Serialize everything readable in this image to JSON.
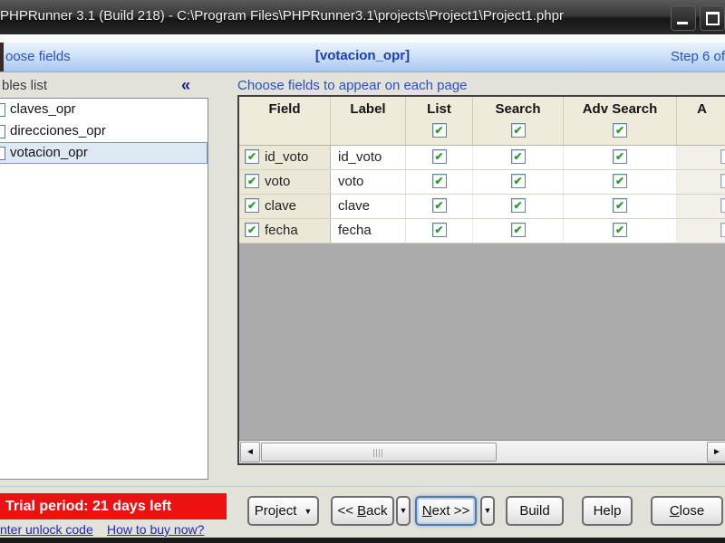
{
  "window": {
    "title": "PHPRunner 3.1 (Build 218) - C:\\Program Files\\PHPRunner3.1\\projects\\Project1\\Project1.phpr"
  },
  "header": {
    "left_label": "oose fields",
    "table_name": "[votacion_opr]",
    "step_label": "Step 6 of"
  },
  "sidebar": {
    "title": "bles list",
    "items": [
      {
        "label": "claves_opr",
        "selected": false
      },
      {
        "label": "direcciones_opr",
        "selected": false
      },
      {
        "label": "votacion_opr",
        "selected": true
      }
    ]
  },
  "main": {
    "caption": "Choose fields to appear on each page",
    "table": {
      "columns": [
        {
          "label": "Field",
          "checkbox": false
        },
        {
          "label": "Label",
          "checkbox": false
        },
        {
          "label": "List",
          "checkbox": true
        },
        {
          "label": "Search",
          "checkbox": true
        },
        {
          "label": "Adv Search",
          "checkbox": true
        },
        {
          "label": "A",
          "checkbox": false
        }
      ],
      "rows": [
        {
          "field": "id_voto",
          "label": "id_voto",
          "field_checked": true,
          "list": true,
          "search": true,
          "adv_search": true
        },
        {
          "field": "voto",
          "label": "voto",
          "field_checked": true,
          "list": true,
          "search": true,
          "adv_search": true
        },
        {
          "field": "clave",
          "label": "clave",
          "field_checked": true,
          "list": true,
          "search": true,
          "adv_search": true
        },
        {
          "field": "fecha",
          "label": "fecha",
          "field_checked": true,
          "list": true,
          "search": true,
          "adv_search": true
        }
      ]
    }
  },
  "footer": {
    "trial_banner": "Trial period: 21 days left",
    "link_unlock": "nter unlock code",
    "link_buy": "How to buy now?",
    "buttons": {
      "project": {
        "pre": "Project"
      },
      "back": {
        "pre": "<< ",
        "accel": "B",
        "post": "ack"
      },
      "next": {
        "pre": "",
        "accel": "N",
        "post": "ext >>"
      },
      "build": {
        "pre": "Build"
      },
      "help": {
        "pre": "Help"
      },
      "close": {
        "pre": "",
        "accel": "C",
        "post": "lose"
      }
    }
  },
  "icons": {
    "collapse": "«",
    "check": "✔",
    "scroll_left": "◄",
    "scroll_right": "►",
    "dropdown": "▼"
  },
  "colors": {
    "main_bg": "#e2e1da",
    "header_text": "#2b50c8",
    "header_title": "#1b3db8",
    "header_border": "#88aede",
    "table_header_bg": "#efebdb",
    "field_cell_bg": "#ece8d8",
    "empty_area": "#ababab",
    "trial_bg": "#ee1111",
    "link_color": "#2222cc",
    "check_green": "#2f9c2f",
    "selection_bg": "#dfe9f6",
    "selection_border": "#7a99bf"
  }
}
